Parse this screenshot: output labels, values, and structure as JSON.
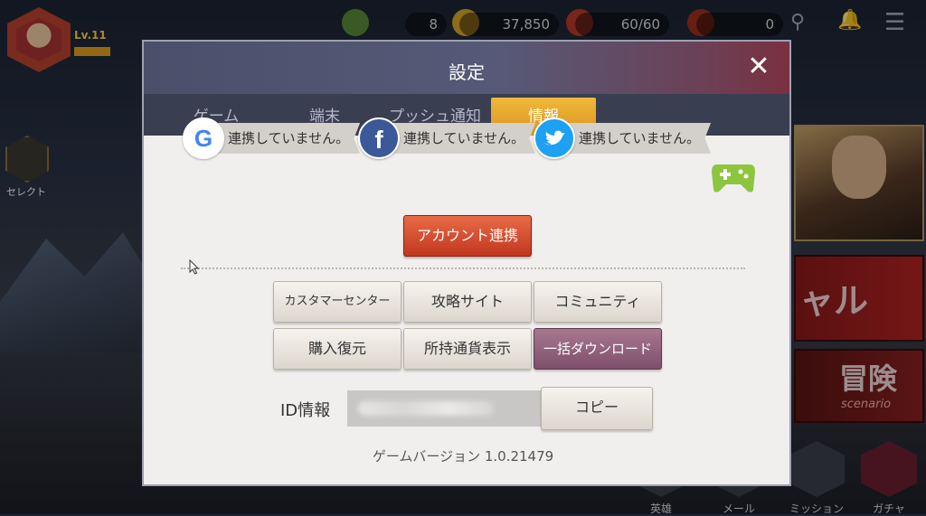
{
  "hud": {
    "level": "Lv.11",
    "stamina_count": "8",
    "coins": "37,850",
    "tickets": "60/60",
    "other": "0"
  },
  "left_menu": {
    "select_label": "セレクト"
  },
  "side_cards": {
    "special_label": "ャル",
    "adventure_label": "冒険",
    "adventure_sub": "scenario"
  },
  "bottom_nav": [
    "英雄",
    "メール",
    "ミッション",
    "ガチャ"
  ],
  "dialog": {
    "title": "設定",
    "tabs": [
      {
        "label": "ゲーム",
        "active": false
      },
      {
        "label": "端末",
        "active": false
      },
      {
        "label": "プッシュ通知",
        "active": false
      },
      {
        "label": "情報",
        "active": true
      }
    ],
    "sns": [
      {
        "service": "google",
        "icon": "google-icon",
        "status": "連携していません。"
      },
      {
        "service": "facebook",
        "icon": "facebook-icon",
        "status": "連携していません。"
      },
      {
        "service": "twitter",
        "icon": "twitter-icon",
        "status": "連携していません。"
      }
    ],
    "account_link_button": "アカウント連携",
    "buttons": {
      "customer_center": "カスタマーセンター",
      "strategy_site": "攻略サイト",
      "community": "コミュニティ",
      "restore_purchase": "購入復元",
      "currency_display": "所持通貨表示",
      "bulk_download": "一括ダウンロード"
    },
    "id_label": "ID情報",
    "copy_button": "コピー",
    "version": "ゲームバージョン 1.0.21479"
  },
  "colors": {
    "accent_tab": "#e4a62a",
    "account_button": "#d44a2c",
    "download_button": "#8e5f7a"
  }
}
